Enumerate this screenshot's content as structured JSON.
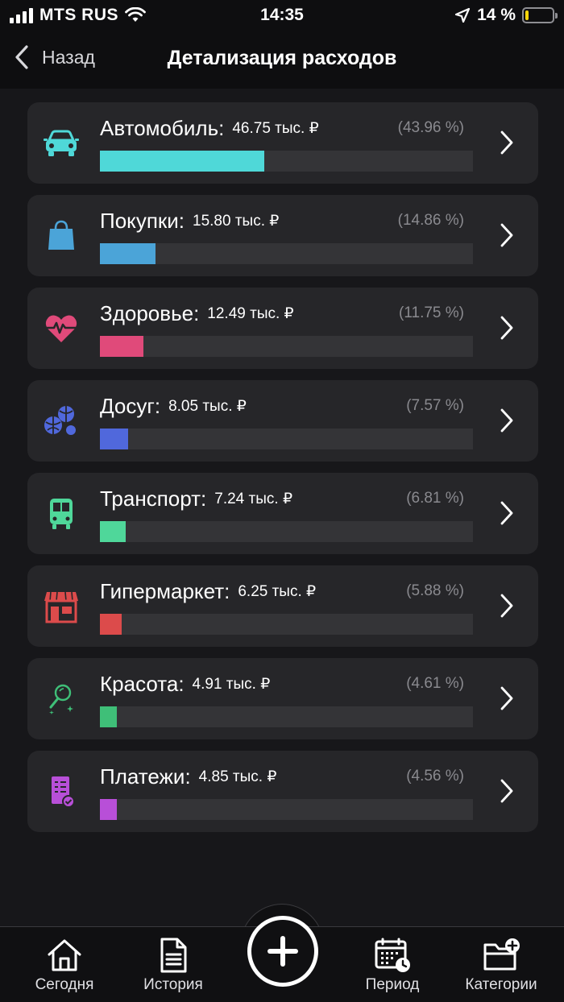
{
  "status": {
    "carrier": "MTS RUS",
    "time": "14:35",
    "battery_text": "14 %",
    "battery_level": 0.14,
    "battery_color": "#ffd60a"
  },
  "nav": {
    "back_label": "Назад",
    "title": "Детализация расходов"
  },
  "categories": [
    {
      "name": "Автомобиль:",
      "amount": "46.75 тыс. ₽",
      "percent_text": "(43.96 %)",
      "share": 0.4396,
      "color": "#4fd8d8",
      "icon": "car-icon"
    },
    {
      "name": "Покупки:",
      "amount": "15.80 тыс. ₽",
      "percent_text": "(14.86 %)",
      "share": 0.1486,
      "color": "#4ba4d8",
      "icon": "shopping-bag-icon"
    },
    {
      "name": "Здоровье:",
      "amount": "12.49 тыс. ₽",
      "percent_text": "(11.75 %)",
      "share": 0.1175,
      "color": "#e04a7a",
      "icon": "heart-pulse-icon"
    },
    {
      "name": "Досуг:",
      "amount": "8.05 тыс. ₽",
      "percent_text": "(7.57 %)",
      "share": 0.0757,
      "color": "#5068dc",
      "icon": "balls-icon"
    },
    {
      "name": "Транспорт:",
      "amount": "7.24 тыс. ₽",
      "percent_text": "(6.81 %)",
      "share": 0.0681,
      "color": "#4fd79a",
      "icon": "bus-icon"
    },
    {
      "name": "Гипермаркет:",
      "amount": "6.25 тыс. ₽",
      "percent_text": "(5.88 %)",
      "share": 0.0588,
      "color": "#dc4b4b",
      "icon": "store-icon"
    },
    {
      "name": "Красота:",
      "amount": "4.91 тыс. ₽",
      "percent_text": "(4.61 %)",
      "share": 0.0461,
      "color": "#3fbf78",
      "icon": "mirror-icon"
    },
    {
      "name": "Платежи:",
      "amount": "4.85 тыс. ₽",
      "percent_text": "(4.56 %)",
      "share": 0.0456,
      "color": "#b84fd8",
      "icon": "payment-receipt-icon"
    }
  ],
  "tabs": {
    "today": "Сегодня",
    "history": "История",
    "period": "Период",
    "categories": "Категории"
  }
}
